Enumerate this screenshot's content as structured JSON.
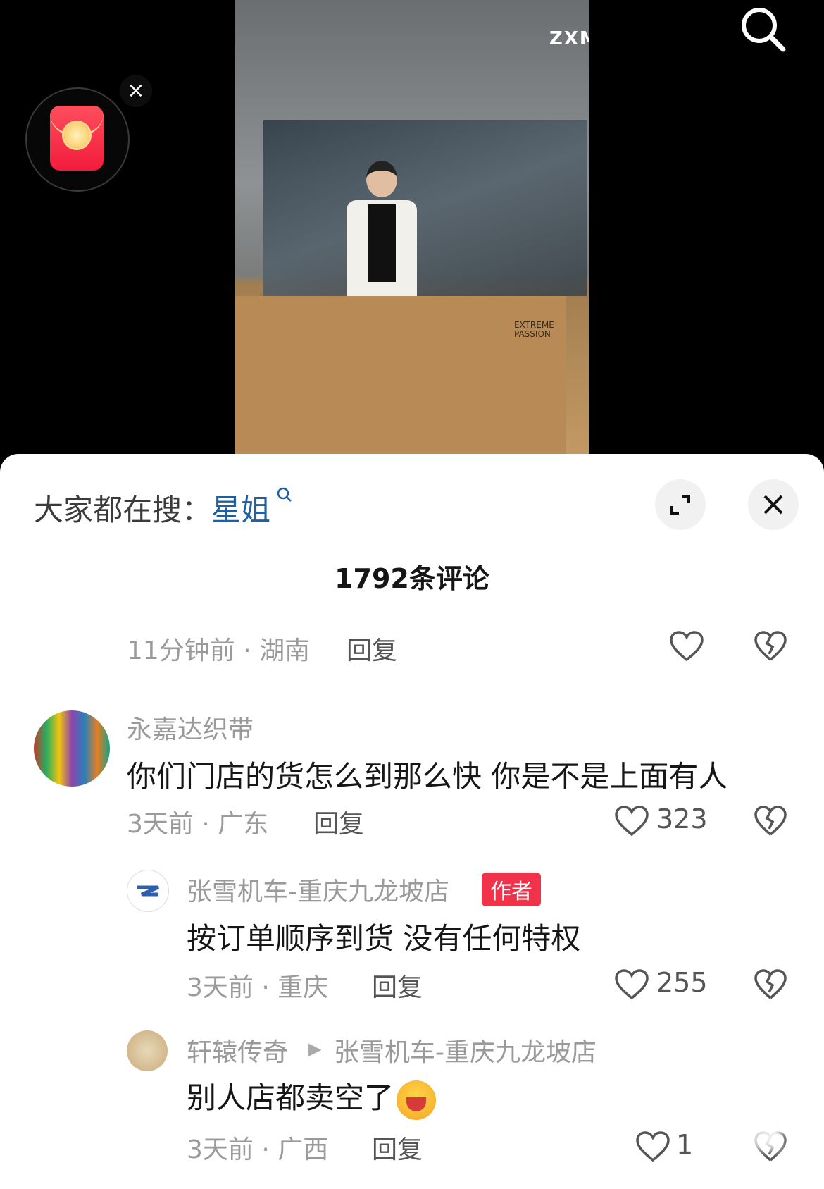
{
  "video": {
    "store_sign": "ZXM",
    "box_label": "EXTREME PASSION"
  },
  "sheet": {
    "hot_search_prefix": "大家都在搜：",
    "hot_search_keyword": "星姐",
    "comment_count": "1792条评论"
  },
  "comments": [
    {
      "meta": "11分钟前 · 湖南",
      "reply": "回复",
      "likes": ""
    },
    {
      "name": "永嘉达织带",
      "text": "你们门店的货怎么到那么快 你是不是上面有人",
      "meta": "3天前 · 广东",
      "reply": "回复",
      "likes": "323"
    },
    {
      "name": "张雪机车-重庆九龙坡店",
      "badge": "作者",
      "text": "按订单顺序到货 没有任何特权",
      "meta": "3天前 · 重庆",
      "reply": "回复",
      "likes": "255"
    },
    {
      "name": "轩辕传奇",
      "reply_to": "张雪机车-重庆九龙坡店",
      "text": "别人店都卖空了",
      "meta": "3天前 · 广西",
      "reply": "回复",
      "likes": "1"
    }
  ]
}
